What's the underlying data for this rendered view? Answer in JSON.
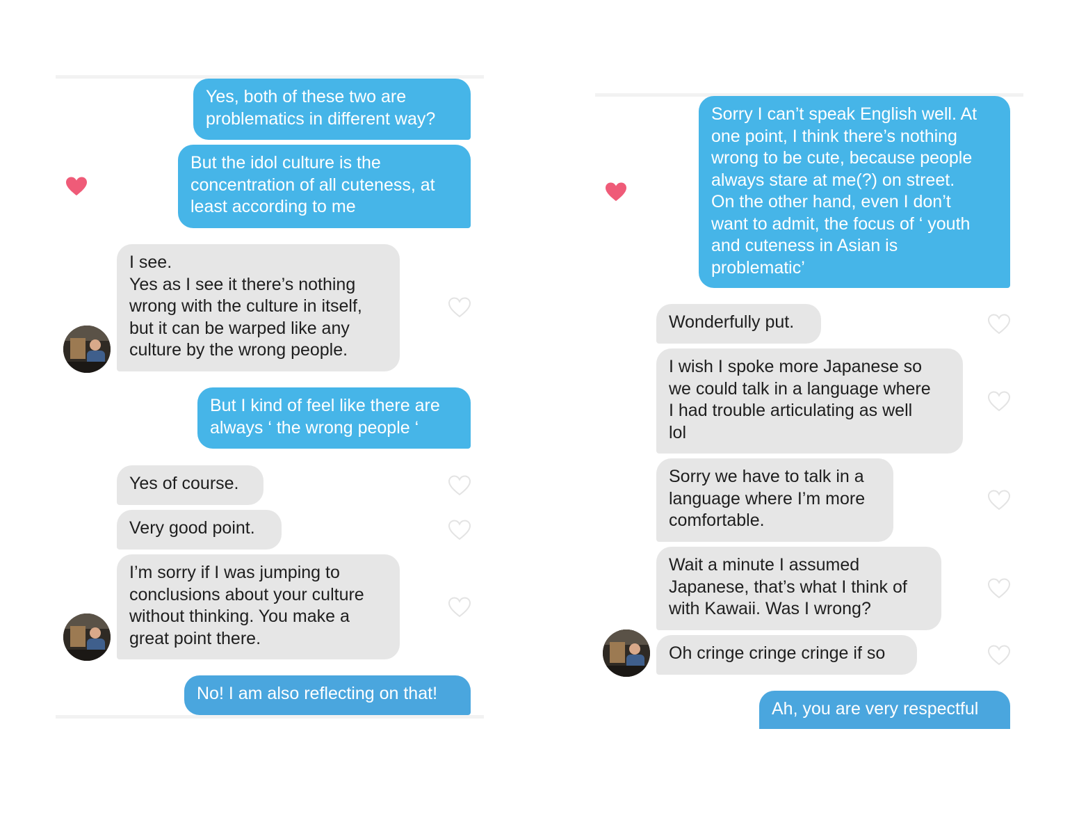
{
  "left_panel": {
    "messages": [
      {
        "side": "out",
        "text": "Yes, both of these two are\nproblematics in different way?"
      },
      {
        "side": "out",
        "text": "But the idol culture is the\nconcentration of all cuteness, at\nleast according to me",
        "liked": true
      },
      {
        "side": "in",
        "text": "I see.\nYes as I see it there’s nothing\nwrong with the culture in itself,\nbut it can be warped like any\nculture by the wrong people."
      },
      {
        "side": "out",
        "text": "But I kind of feel like there are\nalways ‘ the wrong people ‘"
      },
      {
        "side": "in",
        "text": "Yes of course."
      },
      {
        "side": "in",
        "text": "Very good point."
      },
      {
        "side": "in",
        "text": "I’m sorry if I was jumping to\nconclusions about your culture\nwithout thinking. You make a\ngreat point there."
      },
      {
        "side": "out",
        "text": "No! I am also reflecting on that!"
      }
    ]
  },
  "right_panel": {
    "messages": [
      {
        "side": "out",
        "text": "Sorry I can’t speak English well. At\none point, I think there’s nothing\nwrong to be cute, because people\nalways stare at me(?) on street.\nOn the other hand, even I don’t\nwant to admit, the focus of ‘ youth\nand cuteness in Asian is\nproblematic’",
        "liked": true
      },
      {
        "side": "in",
        "text": "Wonderfully put."
      },
      {
        "side": "in",
        "text": "I wish I spoke more Japanese so\nwe could talk in a language where\nI had trouble articulating as well\nlol"
      },
      {
        "side": "in",
        "text": "Sorry we have to talk in a\nlanguage where I’m more\ncomfortable."
      },
      {
        "side": "in",
        "text": "Wait a minute I assumed\nJapanese, that’s what I think of\nwith Kawaii. Was I wrong?"
      },
      {
        "side": "in",
        "text": "Oh cringe cringe cringe if so"
      },
      {
        "side": "out",
        "text": "Ah, you are very respectful"
      }
    ]
  },
  "colors": {
    "outgoing": "#46b5e8",
    "incoming": "#e6e6e6",
    "liked_heart": "#ef5b78",
    "empty_heart": "#e3e3e3"
  }
}
